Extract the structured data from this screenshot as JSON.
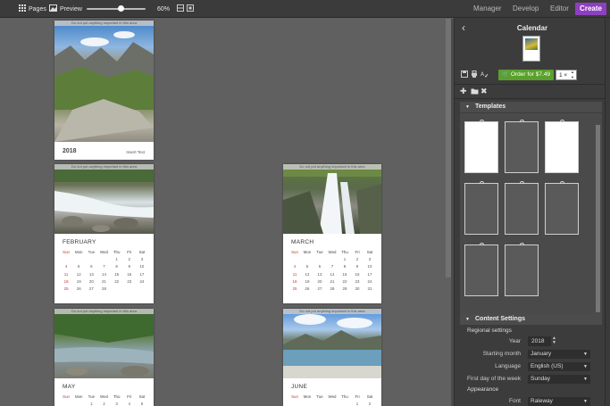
{
  "toolbar": {
    "pages_label": "Pages",
    "preview_label": "Preview",
    "zoom_value": "60%",
    "zoom_level": 0.6,
    "modes": [
      "Manager",
      "Develop",
      "Editor"
    ],
    "create_label": "Create",
    "accent_color": "#8e3fbf"
  },
  "canvas": {
    "warning_text": "Do not put anything important in this area",
    "cover": {
      "year": "2018",
      "insert_text": "Insert Text"
    },
    "weekdays": [
      "Sun",
      "Mon",
      "Tue",
      "Wed",
      "Thu",
      "Fri",
      "Sat"
    ],
    "february": {
      "name": "FEBRUARY",
      "days": [
        "",
        "",
        "",
        "",
        "1",
        "2",
        "3",
        "4",
        "5",
        "6",
        "7",
        "8",
        "9",
        "10",
        "11",
        "12",
        "13",
        "14",
        "15",
        "16",
        "17",
        "18",
        "19",
        "20",
        "21",
        "22",
        "23",
        "24",
        "25",
        "26",
        "27",
        "28",
        "",
        "",
        ""
      ]
    },
    "march": {
      "name": "MARCH",
      "days": [
        "",
        "",
        "",
        "",
        "1",
        "2",
        "3",
        "4",
        "5",
        "6",
        "7",
        "8",
        "9",
        "10",
        "11",
        "12",
        "13",
        "14",
        "15",
        "16",
        "17",
        "18",
        "19",
        "20",
        "21",
        "22",
        "23",
        "24",
        "25",
        "26",
        "27",
        "28",
        "29",
        "30",
        "31"
      ]
    },
    "may": {
      "name": "MAY",
      "days_row1": [
        "",
        "",
        "1",
        "2",
        "3",
        "4",
        "5"
      ]
    },
    "june": {
      "name": "JUNE",
      "days_row1": [
        "",
        "",
        "",
        "",
        "",
        "1",
        "2"
      ]
    }
  },
  "panel": {
    "title": "Calendar",
    "order_label": "Order for $7.49",
    "quantity": "1 ×",
    "templates_title": "Templates",
    "content_settings_title": "Content Settings",
    "regional_settings_label": "Regional settings",
    "fields": {
      "year_label": "Year",
      "year_value": "2018",
      "starting_month_label": "Starting month",
      "starting_month_value": "January",
      "language_label": "Language",
      "language_value": "English (US)",
      "first_day_label": "First day of the week",
      "first_day_value": "Sunday",
      "appearance_label": "Appearance",
      "font_label": "Font",
      "font_value": "Raleway"
    },
    "order_color": "#5aa02c"
  }
}
